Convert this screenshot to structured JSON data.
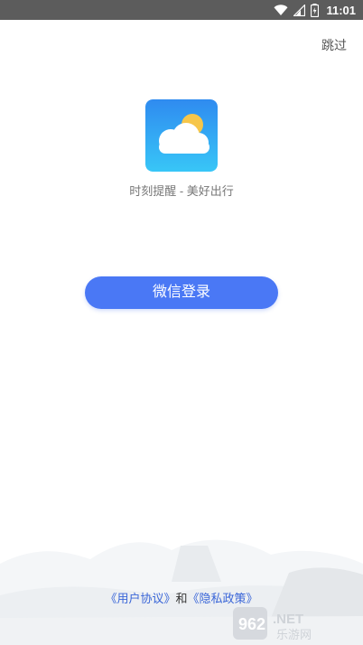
{
  "status_bar": {
    "time": "11:01",
    "icons": [
      "wifi-icon",
      "cell-signal-icon",
      "battery-icon"
    ]
  },
  "header": {
    "skip_label": "跳过"
  },
  "app": {
    "name": "时刻提醒 - 美好出行",
    "logo_icon": "weather-cloud-sun-icon"
  },
  "login": {
    "wechat_button_label": "微信登录"
  },
  "agreement": {
    "user_agreement": "《用户协议》",
    "connector": "和",
    "privacy_policy": "《隐私政策》"
  },
  "watermark": {
    "number": "962",
    "suffix": ".NET",
    "site_name": "乐游网"
  },
  "colors": {
    "status_bar": "#5c5c5c",
    "primary_button": "#4a78f5",
    "link": "#3a66d8",
    "logo_gradient_top": "#2f8bf0",
    "logo_gradient_bottom": "#38c6f7",
    "sun": "#f6c64a"
  }
}
